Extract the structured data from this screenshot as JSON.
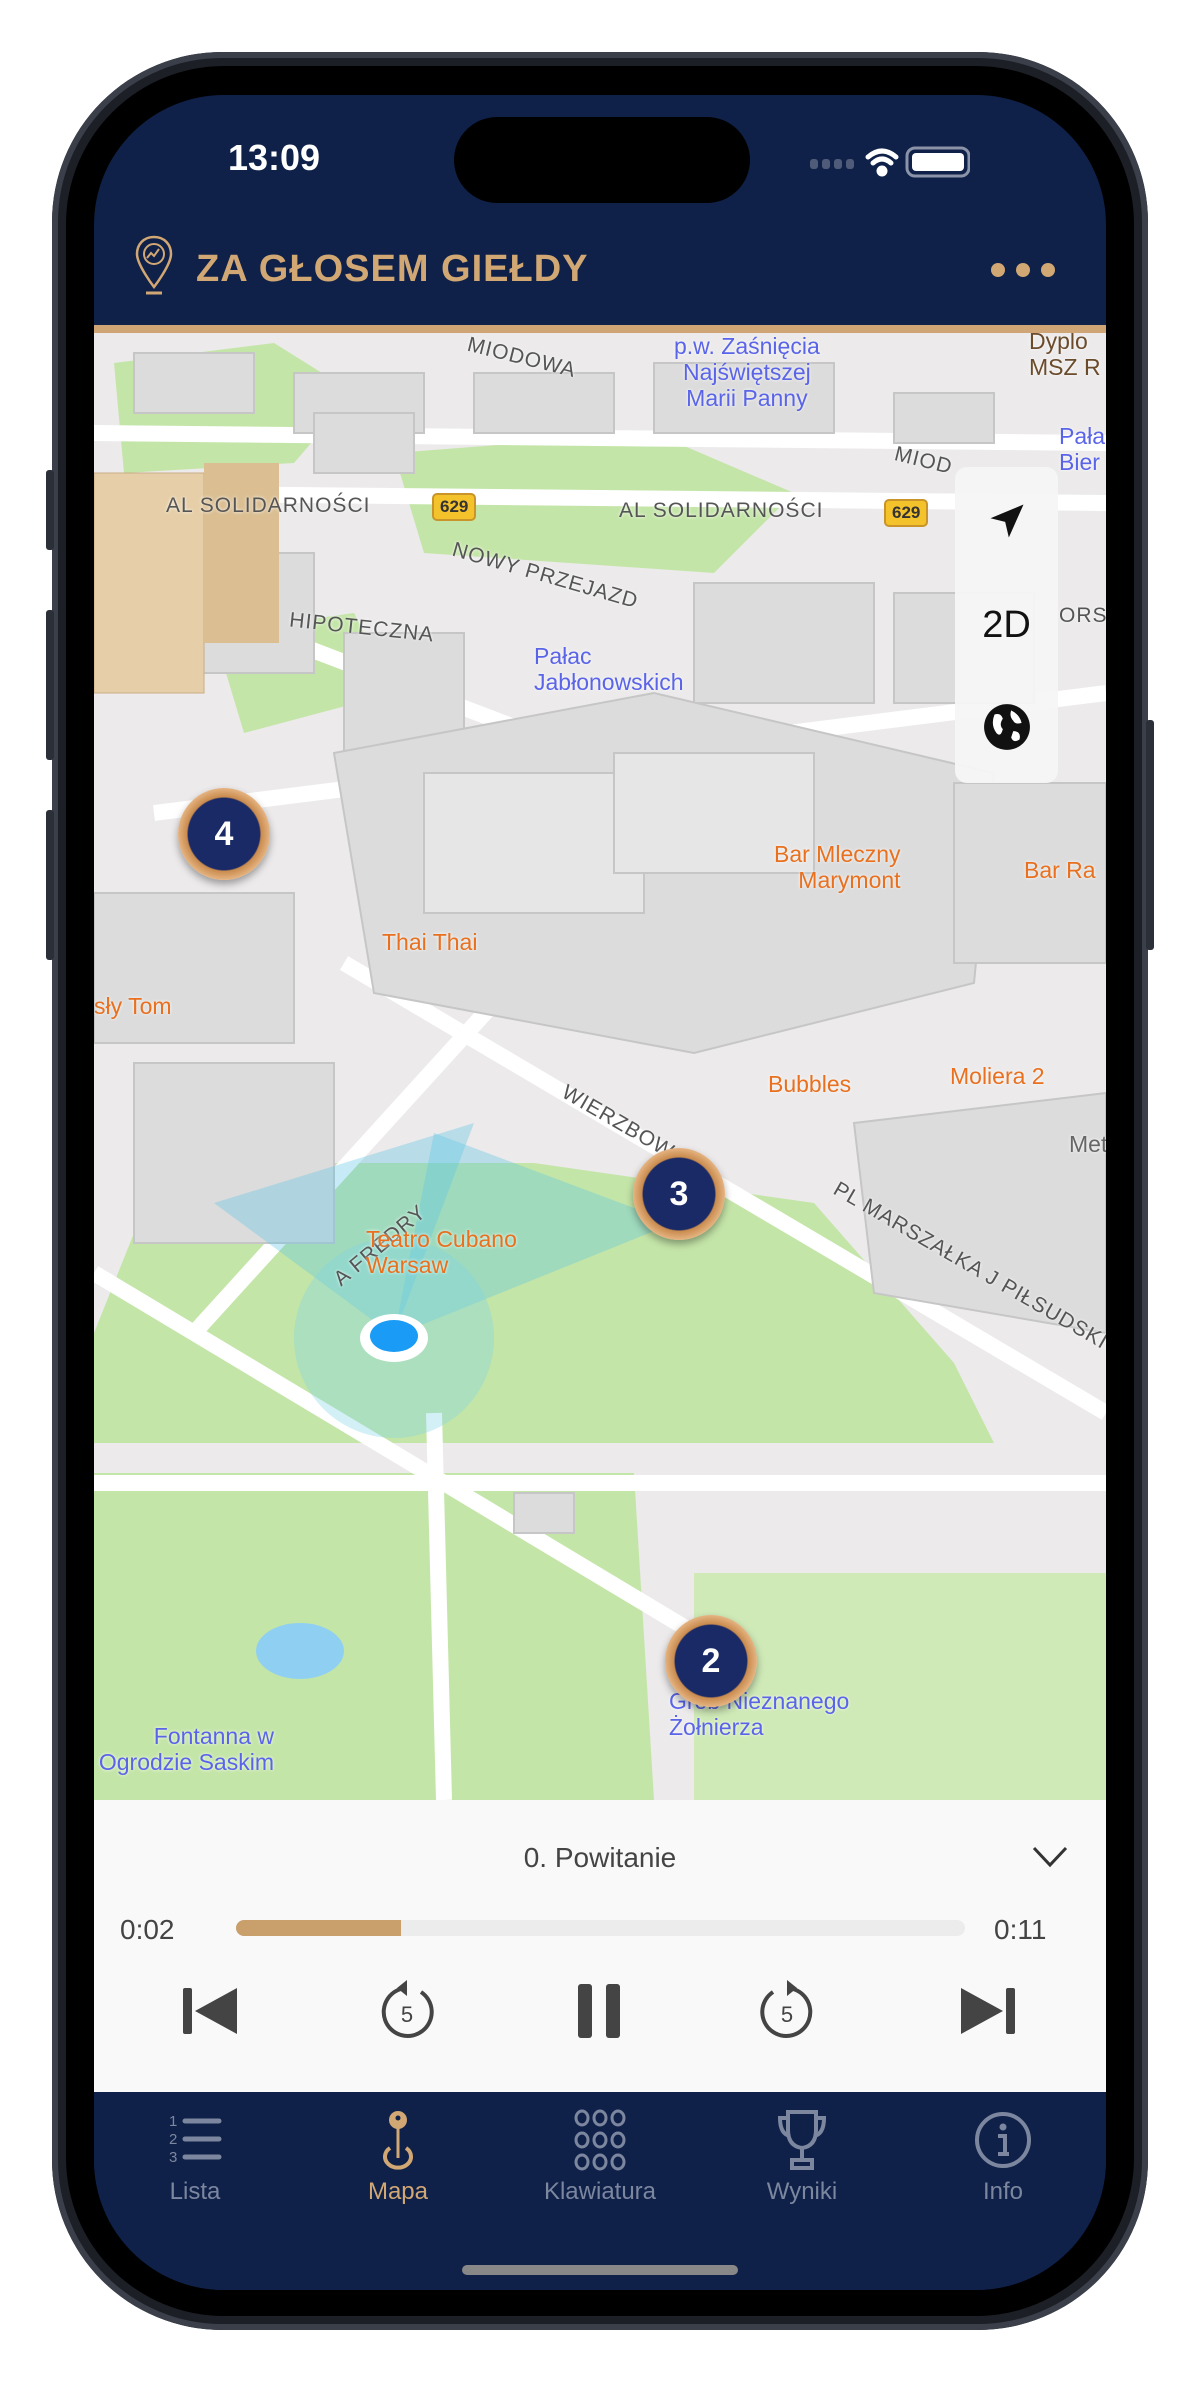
{
  "status_bar": {
    "time": "13:09"
  },
  "header": {
    "title": "ZA GŁOSEM GIEŁDY",
    "logo_icon": "map-pin-chart-icon",
    "menu_icon": "more-dots-icon"
  },
  "colors": {
    "navy": "#0f2149",
    "gold": "#d1a774",
    "progress": "#c9a06b"
  },
  "map": {
    "streets": [
      "MIODOWA",
      "AL SOLIDARNOŚCI",
      "AL SOLIDARNOŚCI",
      "MIOD",
      "NOWY PRZEJAZD",
      "HIPOTECZNA",
      "WIERZBOWA",
      "A FREDRY",
      "PL MARSZAŁKA J PIŁSUDSKI",
      "ORSK"
    ],
    "road_badges": [
      "629",
      "629"
    ],
    "landmarks": [
      "p.w. Zaśnięcia\nNajświętszej\nMarii Panny",
      "Pałac\nJabłonowskich",
      "Grób Nieznanego\nŻołnierza",
      "Fontanna w\nOgrodzie Saskim",
      "Pała\nBier"
    ],
    "pois": [
      "Bar Mleczny\nMarymont",
      "Bar Ra",
      "Thai Thai",
      "sły Tom",
      "Bubbles",
      "Moliera 2",
      "Teatro Cubano\nWarsaw",
      "Dyplo\nMSZ R",
      "Met"
    ],
    "markers": [
      "4",
      "3",
      "2"
    ],
    "controls": {
      "location_icon": "location-arrow-icon",
      "mode": "2D",
      "globe_icon": "globe-icon"
    }
  },
  "player": {
    "title": "0. Powitanie",
    "elapsed": "0:02",
    "duration": "0:11",
    "progress": 0.226
  },
  "tabs": [
    {
      "label": "Lista",
      "icon": "numbered-list-icon"
    },
    {
      "label": "Mapa",
      "icon": "map-pin-icon",
      "active": true
    },
    {
      "label": "Klawiatura",
      "icon": "keypad-icon"
    },
    {
      "label": "Wyniki",
      "icon": "trophy-icon"
    },
    {
      "label": "Info",
      "icon": "info-icon"
    }
  ]
}
